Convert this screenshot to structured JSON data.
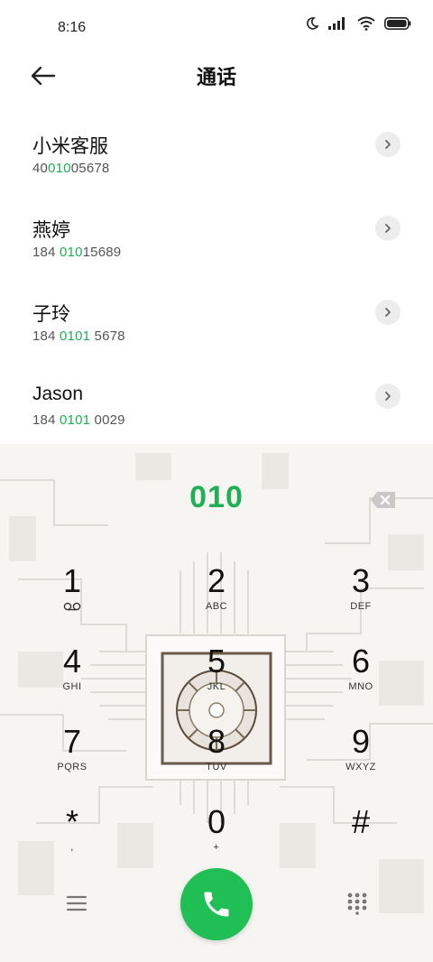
{
  "status": {
    "time": "8:16"
  },
  "header": {
    "title": "通话"
  },
  "contacts": [
    {
      "name": "小米客服",
      "number_pre": "40",
      "number_hl": "010",
      "number_post": "05678"
    },
    {
      "name": "燕婷",
      "number_pre": "184 ",
      "number_hl": "010",
      "number_post": "15689"
    },
    {
      "name": "子玲",
      "number_pre": "184 ",
      "number_hl": "0101",
      "number_post": " 5678"
    },
    {
      "name": "Jason",
      "number_pre": "184 ",
      "number_hl": "0101",
      "number_post": " 0029"
    }
  ],
  "dialer": {
    "entered": "010",
    "keys": [
      {
        "digit": "1",
        "letters": ""
      },
      {
        "digit": "2",
        "letters": "ABC"
      },
      {
        "digit": "3",
        "letters": "DEF"
      },
      {
        "digit": "4",
        "letters": "GHI"
      },
      {
        "digit": "5",
        "letters": "JKL"
      },
      {
        "digit": "6",
        "letters": "MNO"
      },
      {
        "digit": "7",
        "letters": "PQRS"
      },
      {
        "digit": "8",
        "letters": "TUV"
      },
      {
        "digit": "9",
        "letters": "WXYZ"
      },
      {
        "digit": "*",
        "letters": ","
      },
      {
        "digit": "0",
        "letters": "+"
      },
      {
        "digit": "#",
        "letters": ""
      }
    ]
  },
  "colors": {
    "accent": "#1fb055",
    "call": "#1fbf55"
  }
}
